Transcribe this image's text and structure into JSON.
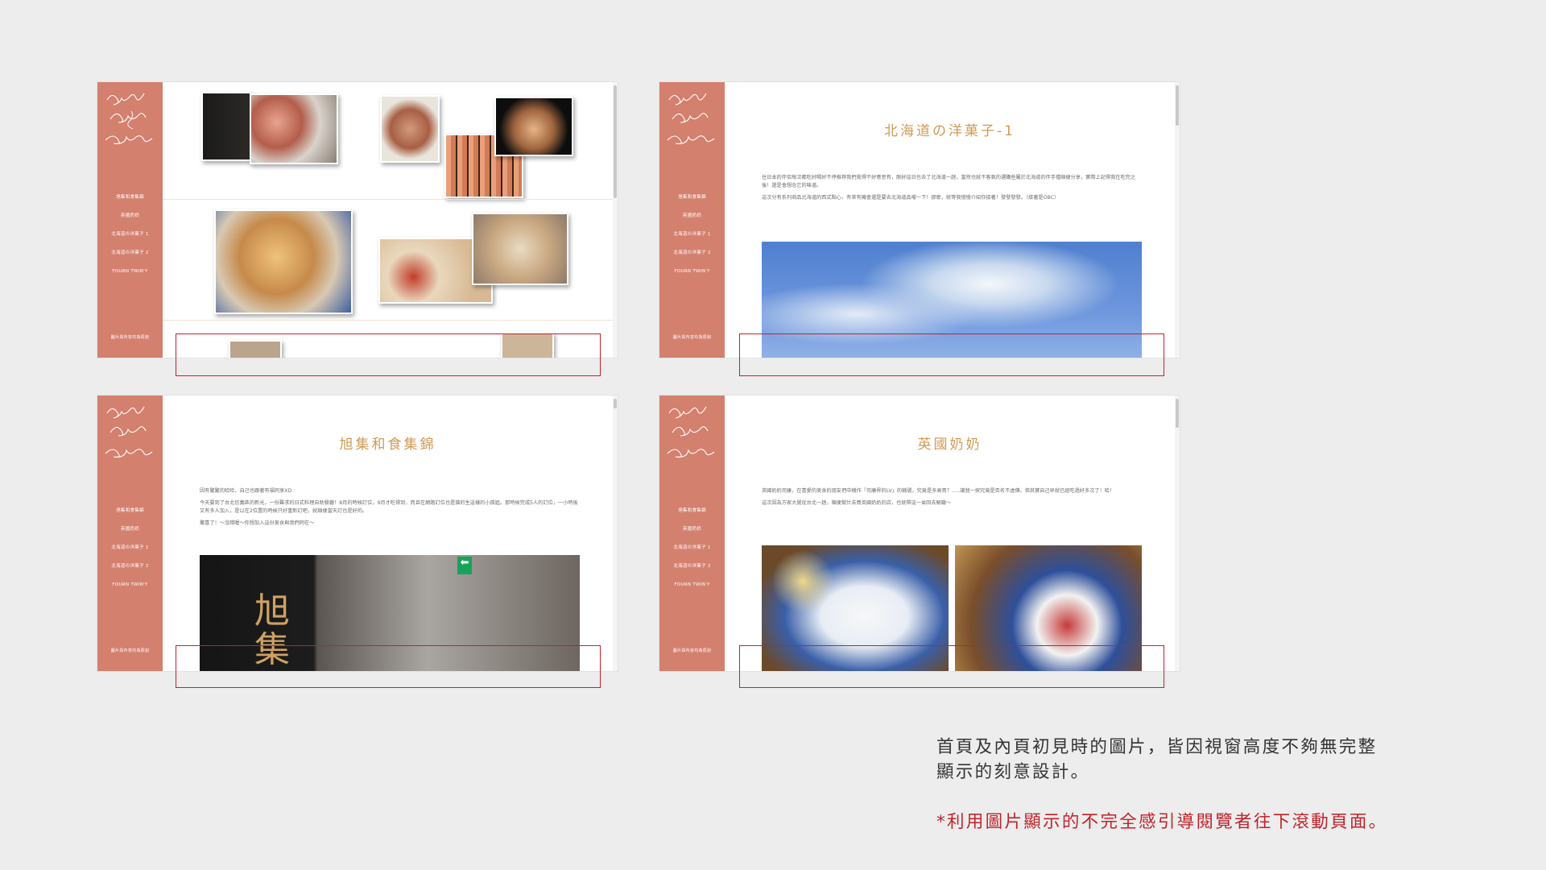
{
  "nav_items": [
    "旭集和食集錦",
    "英國奶奶",
    "北海道の洋菓子 1",
    "北海道の洋菓子 2",
    "FOURN TWIN'Y"
  ],
  "footer_text": "圖片與內容均為原創",
  "page2": {
    "title": "北海道の洋菓子-1",
    "paragraphs": [
      "住日本的伴侶每次都吃好喝好不停推荐我們覺得不好意思有，剛好這日也去了北海道一趟，當然也就不客氣的選購些屬於北海道的伴手禮順便分享，實際上記得我在吃完之後！還是會想念它的味道。",
      "這次分有系列商品北海道的西式點心，有來有機會還是要去北海道品嚐一下！那麼，就等我慢慢介紹你接著！發發發發。（接著是OBC）"
    ]
  },
  "page3": {
    "title": "旭集和食集錦",
    "paragraphs": [
      "因有驚驚的哈哈，自己也跟著有福同享XD",
      "今天要到了台北信義區的新光，一份難求的日式料理自助餐廳！8月的時候訂位，9月才吃得到，而且在網路訂位也是搶的生這樣的小孤姐。那時候完成5人的訂位，一小時後又有多人加入，是以在2位置的時候只好重新訂吧，就順便當天訂也是好的。",
      "驚喜了！～沒錯喔～你想加入這份美食與我們同在～"
    ]
  },
  "page4": {
    "title": "英國奶奶",
    "paragraphs": [
      "英國奶奶司康，在喜愛的美食的朋友們中稱作「司康界的LV」的稱號，究竟是多高貴？…‥讓我一探究竟是否名不虛傳，但其實自己早就已經吃過好多次了！哈！",
      "這次因為方家大舅從台北一趟，順便幫忙去買英國奶奶的店，也就帶這一並回去解饞～"
    ]
  },
  "caption": {
    "line1": "首頁及內頁初見時的圖片，皆因視窗高度不夠無完整",
    "line2": "顯示的刻意設計。",
    "note": "*利用圖片顯示的不完全感引導閱覽者往下滾動頁面。"
  },
  "colors": {
    "sidebar": "#d4806e",
    "title_gold": "#cf9a55",
    "highlight_red": "#c0232b"
  }
}
